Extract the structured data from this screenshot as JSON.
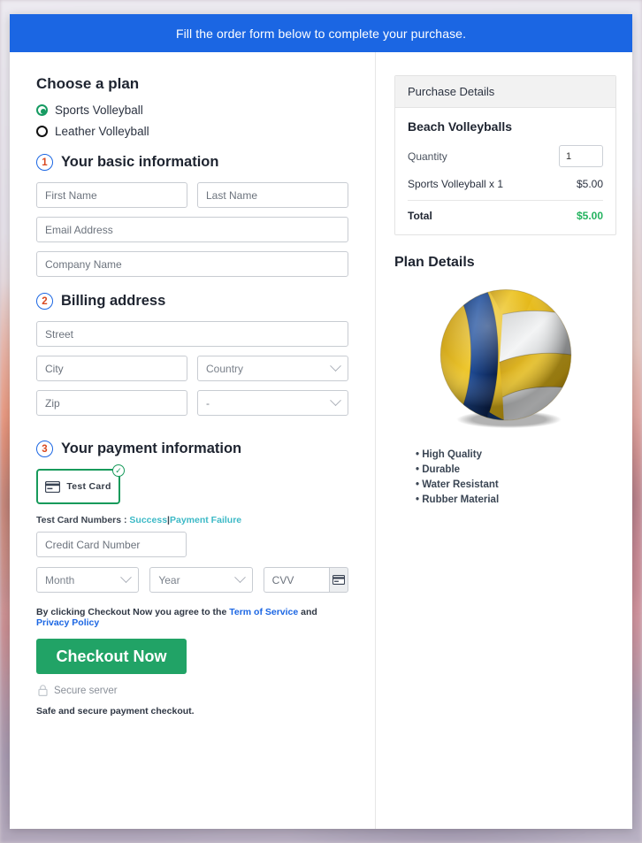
{
  "topbar": {
    "message": "Fill the order form below to complete your purchase."
  },
  "plan": {
    "heading": "Choose a plan",
    "options": [
      {
        "label": "Sports Volleyball",
        "selected": true
      },
      {
        "label": "Leather Volleyball",
        "selected": false
      }
    ]
  },
  "steps": [
    {
      "number": "1",
      "title": "Your basic information"
    },
    {
      "number": "2",
      "title": "Billing address"
    },
    {
      "number": "3",
      "title": "Your payment information"
    }
  ],
  "basic_info": {
    "first_name_placeholder": "First Name",
    "last_name_placeholder": "Last Name",
    "email_placeholder": "Email Address",
    "company_placeholder": "Company Name"
  },
  "billing": {
    "street_placeholder": "Street",
    "city_placeholder": "City",
    "country_placeholder": "Country",
    "zip_placeholder": "Zip",
    "state_placeholder": "-"
  },
  "payment": {
    "card_tile_label": "Test  Card",
    "test_card_prefix": "Test Card Numbers :",
    "test_card_success": "Success",
    "test_card_divider": "|",
    "test_card_failure": "Payment Failure",
    "card_number_placeholder": "Credit Card Number",
    "month_placeholder": "Month",
    "year_placeholder": "Year",
    "cvv_placeholder": "CVV",
    "terms_prefix": "By clicking Checkout Now you agree to the",
    "terms_link": "Term of Service",
    "terms_and": "and",
    "privacy_link": "Privacy Policy",
    "checkout_label": "Checkout Now",
    "secure_server": "Secure server",
    "safe_note": "Safe and secure payment checkout."
  },
  "purchase": {
    "panel_title": "Purchase Details",
    "product_name": "Beach Volleyballs",
    "quantity_label": "Quantity",
    "quantity_value": "1",
    "line_item_label": "Sports Volleyball x 1",
    "line_item_price": "$5.00",
    "total_label": "Total",
    "total_price": "$5.00"
  },
  "plan_details": {
    "heading": "Plan Details",
    "features": [
      "High Quality",
      "Durable",
      "Water Resistant",
      "Rubber  Material"
    ]
  },
  "colors": {
    "topbar_blue": "#1b66e3",
    "accent_green": "#21a366",
    "total_green": "#24b35f",
    "teal_link": "#3cb9c6",
    "blue_link": "#1b66e3",
    "step_circle": "#1b66e3",
    "step_number": "#d9481f"
  }
}
